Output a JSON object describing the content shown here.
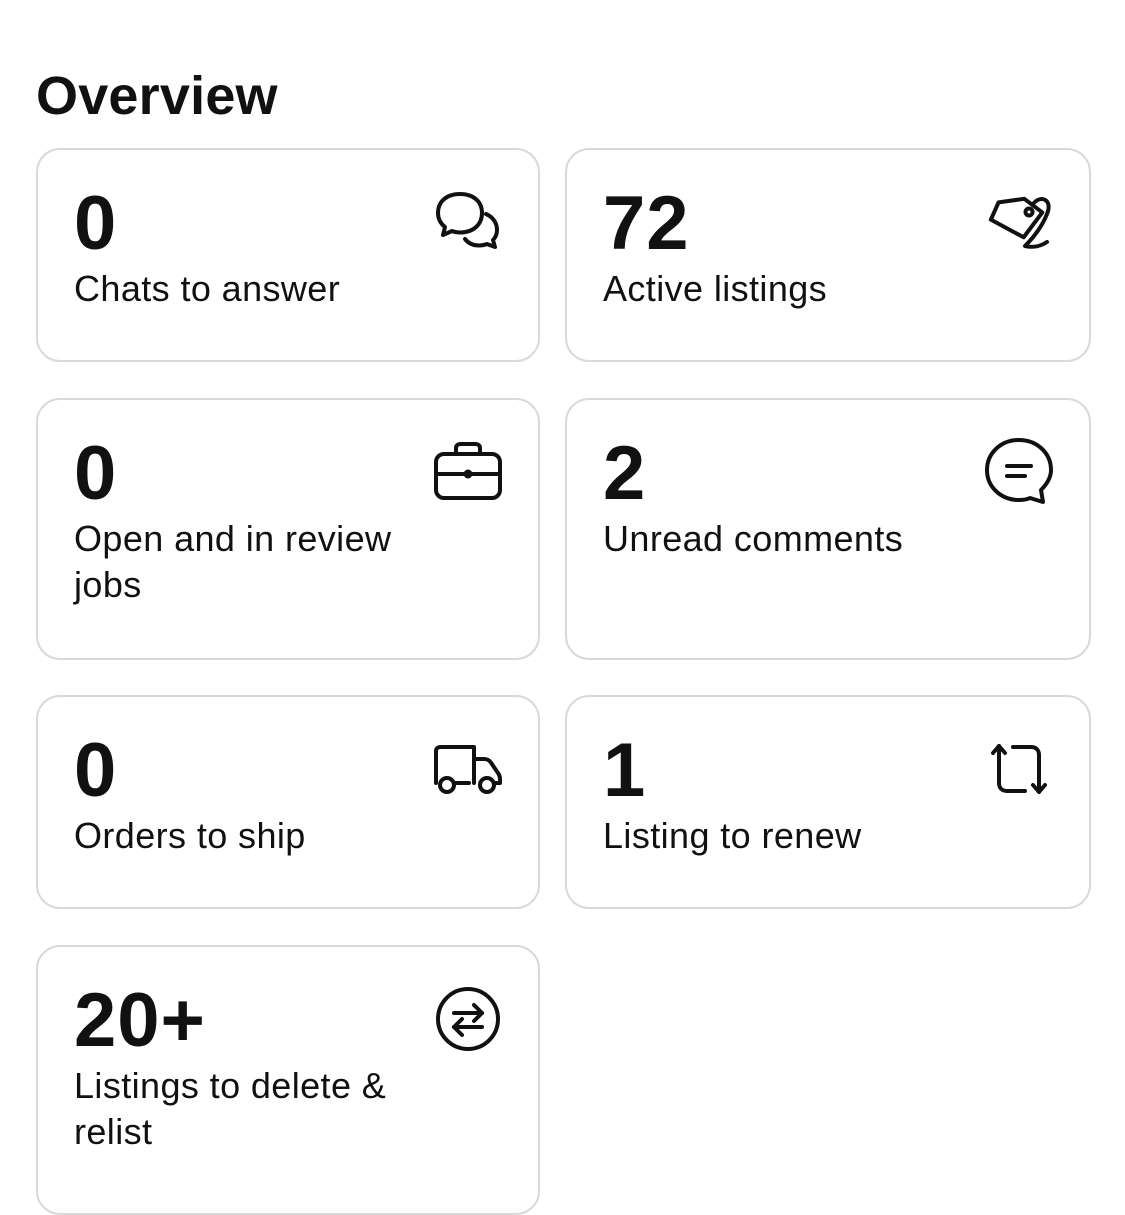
{
  "header": {
    "title": "Overview"
  },
  "cards": [
    {
      "count": "0",
      "label": "Chats to answer",
      "icon": "chat-bubbles-icon"
    },
    {
      "count": "72",
      "label": "Active listings",
      "icon": "tag-icon"
    },
    {
      "count": "0",
      "label": "Open and in review jobs",
      "icon": "briefcase-icon"
    },
    {
      "count": "2",
      "label": "Unread comments",
      "icon": "comment-icon"
    },
    {
      "count": "0",
      "label": "Orders to ship",
      "icon": "truck-icon"
    },
    {
      "count": "1",
      "label": "Listing to renew",
      "icon": "renew-icon"
    },
    {
      "count": "20+",
      "label": "Listings to delete & relist",
      "icon": "swap-arrows-icon"
    }
  ]
}
